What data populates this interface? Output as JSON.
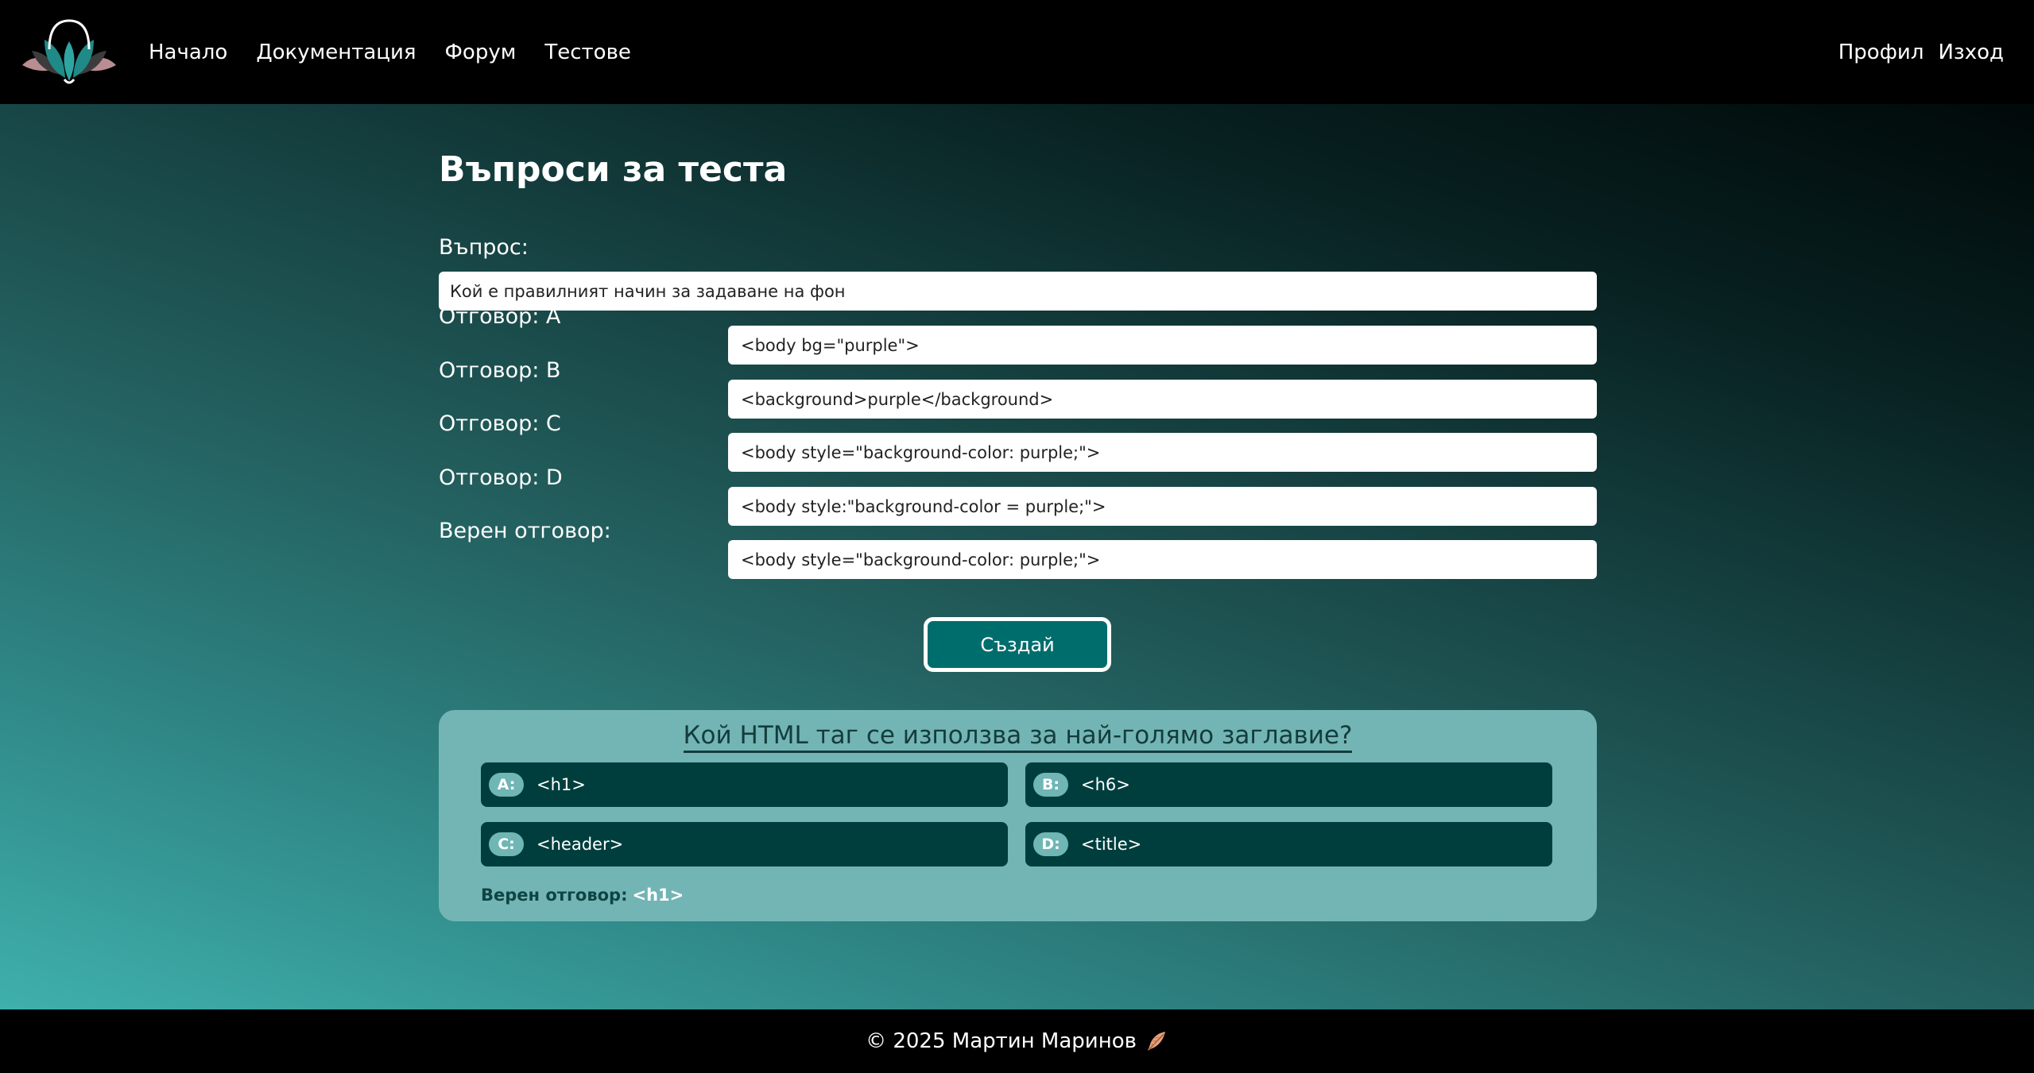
{
  "nav": {
    "items": [
      {
        "label": "Начало"
      },
      {
        "label": "Документация"
      },
      {
        "label": "Форум"
      },
      {
        "label": "Тестове"
      }
    ],
    "right": [
      {
        "label": "Профил"
      },
      {
        "label": "Изход"
      }
    ]
  },
  "page": {
    "title": "Въпроси за теста",
    "question_label": "Въпрос:",
    "question_value": "Кой е правилният начин за задаване на фон",
    "answers": [
      {
        "label": "Отговор: A",
        "value": "<body bg=\"purple\">"
      },
      {
        "label": "Отговор: B",
        "value": "<background>purple</background>"
      },
      {
        "label": "Отговор: C",
        "value": "<body style=\"background-color: purple;\">"
      },
      {
        "label": "Отговор: D",
        "value": "<body style:\"background-color = purple;\">"
      },
      {
        "label": "Верен отговор:",
        "value": "<body style=\"background-color: purple;\">"
      }
    ],
    "create_label": "Създай"
  },
  "card": {
    "question": "Кой HTML таг се използва за най-голямо заглавие?",
    "options": [
      {
        "badge": "A:",
        "text": "<h1>"
      },
      {
        "badge": "B:",
        "text": "<h6>"
      },
      {
        "badge": "C:",
        "text": "<header>"
      },
      {
        "badge": "D:",
        "text": "<title>"
      }
    ],
    "correct_label": "Верен отговор:",
    "correct_value": "<h1>"
  },
  "footer": {
    "text": "© 2025 Мартин Маринов"
  },
  "icons": {
    "logo": "lotus-logo-icon",
    "footer": "feather-icon"
  },
  "colors": {
    "accent": "#006d6d",
    "card": "#73b5b5",
    "option_bg": "#003e3e"
  }
}
